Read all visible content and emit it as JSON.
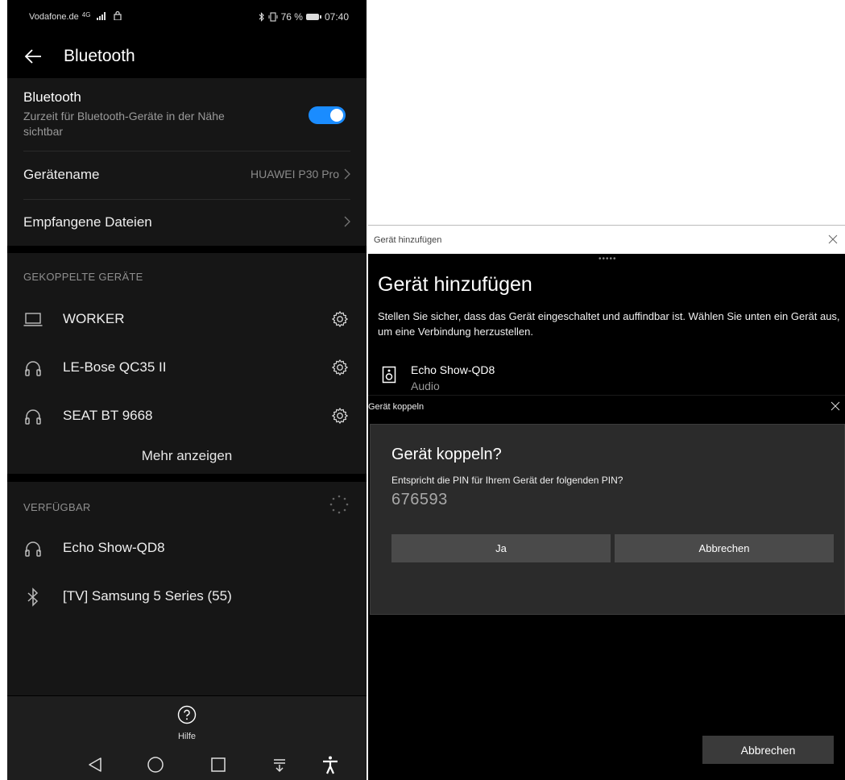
{
  "phone": {
    "status": {
      "carrier": "Vodafone.de",
      "network": "4G",
      "battery": "76 %",
      "time": "07:40"
    },
    "appbar": {
      "title": "Bluetooth"
    },
    "bluetooth": {
      "title": "Bluetooth",
      "subtitle": "Zurzeit für Bluetooth-Geräte in der Nähe sichtbar",
      "enabled": true
    },
    "device_name": {
      "label": "Gerätename",
      "value": "HUAWEI P30 Pro"
    },
    "received_files": {
      "label": "Empfangene Dateien"
    },
    "paired": {
      "header": "GEKOPPELTE GERÄTE",
      "devices": [
        {
          "name": "WORKER",
          "icon": "laptop-icon"
        },
        {
          "name": "LE-Bose QC35 II",
          "icon": "headset-icon"
        },
        {
          "name": "SEAT BT 9668",
          "icon": "headset-icon"
        }
      ],
      "more": "Mehr anzeigen"
    },
    "available": {
      "header": "VERFÜGBAR",
      "devices": [
        {
          "name": "Echo Show-QD8",
          "icon": "headset-icon"
        },
        {
          "name": "[TV] Samsung 5 Series (55)",
          "icon": "bluetooth-icon"
        }
      ]
    },
    "help": {
      "label": "Hilfe"
    },
    "accent": "#1a8cff"
  },
  "windows": {
    "titlebar": "Gerät hinzufügen",
    "heading": "Gerät hinzufügen",
    "instructions": "Stellen Sie sicher, dass das Gerät eingeschaltet und auffindbar ist. Wählen Sie unten ein Gerät aus, um eine Verbindung herzustellen.",
    "device": {
      "name": "Echo Show-QD8",
      "type": "Audio"
    },
    "pair_dialog": {
      "titlebar": "Gerät koppeln",
      "heading": "Gerät koppeln?",
      "question": "Entspricht die PIN für Ihrem Gerät der folgenden PIN?",
      "pin": "676593",
      "yes": "Ja",
      "cancel": "Abbrechen"
    },
    "cancel": "Abbrechen"
  }
}
